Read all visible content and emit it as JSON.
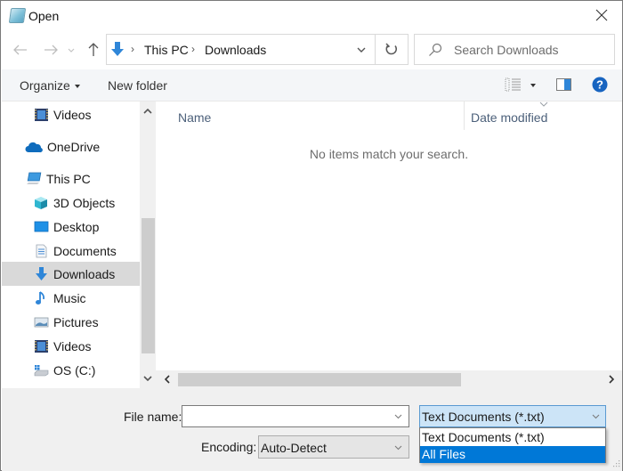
{
  "window": {
    "title": "Open",
    "close_icon": "close-icon"
  },
  "navigation": {
    "back_icon": "arrow-left-icon",
    "forward_icon": "arrow-right-icon",
    "recent_icon": "chevron-down-icon",
    "up_icon": "arrow-up-icon",
    "breadcrumb": [
      "This PC",
      "Downloads"
    ],
    "refresh_icon": "refresh-icon",
    "search_placeholder": "Search Downloads"
  },
  "toolbar": {
    "organize_label": "Organize",
    "new_folder_label": "New folder",
    "view_icon": "details-view-icon",
    "preview_icon": "preview-pane-icon",
    "help_icon": "help-icon"
  },
  "sidebar": {
    "items": [
      {
        "label": "Videos",
        "icon": "videos-icon",
        "level": 1
      },
      {
        "label": "OneDrive",
        "icon": "onedrive-cloud-icon",
        "level": 0
      },
      {
        "label": "This PC",
        "icon": "this-pc-icon",
        "level": 0
      },
      {
        "label": "3D Objects",
        "icon": "3d-objects-icon",
        "level": 1
      },
      {
        "label": "Desktop",
        "icon": "desktop-icon",
        "level": 1
      },
      {
        "label": "Documents",
        "icon": "documents-icon",
        "level": 1
      },
      {
        "label": "Downloads",
        "icon": "downloads-icon",
        "level": 1,
        "selected": true
      },
      {
        "label": "Music",
        "icon": "music-icon",
        "level": 1
      },
      {
        "label": "Pictures",
        "icon": "pictures-icon",
        "level": 1
      },
      {
        "label": "Videos",
        "icon": "videos-icon",
        "level": 1
      },
      {
        "label": "OS (C:)",
        "icon": "drive-icon",
        "level": 1
      }
    ]
  },
  "content": {
    "columns": [
      "Name",
      "Date modified"
    ],
    "empty_message": "No items match your search."
  },
  "footer": {
    "file_name_label": "File name:",
    "file_name_value": "",
    "file_type_selected": "Text Documents (*.txt)",
    "file_type_options": [
      "Text Documents (*.txt)",
      "All Files"
    ],
    "file_type_highlighted": "All Files",
    "encoding_label": "Encoding:",
    "encoding_value": "Auto-Detect"
  },
  "colors": {
    "accent": "#0078d7",
    "selection_bg": "#d9d9d9",
    "combo_focus_bg": "#cce4f7"
  }
}
